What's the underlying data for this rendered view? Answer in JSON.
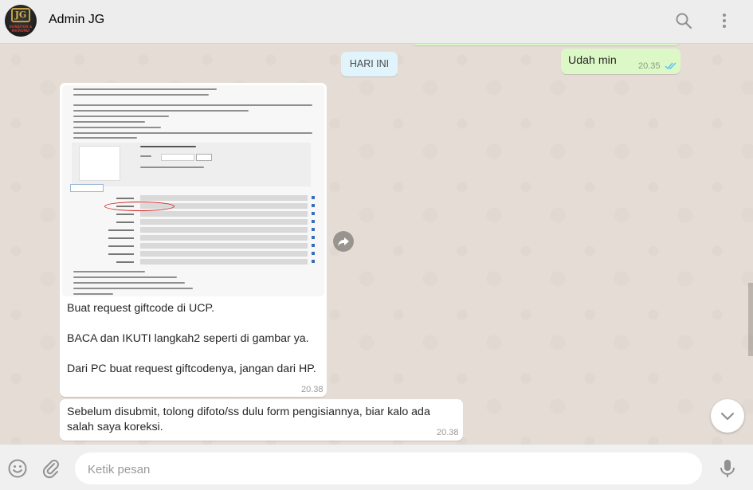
{
  "header": {
    "title": "Admin JG",
    "avatar_text": "JG",
    "avatar_subtext": "DONATION & MICROPAY",
    "icons": [
      "search-icon",
      "menu-icon"
    ]
  },
  "chat": {
    "day_label": "HARI INI",
    "outgoing": [
      {
        "text": "Udah min",
        "time": "20.35",
        "status": "read"
      }
    ],
    "incoming": [
      {
        "has_image": true,
        "lines": [
          "Buat request giftcode di UCP.",
          "BACA dan IKUTI langkah2 seperti di gambar ya.",
          "Dari PC buat request giftcodenya, jangan dari HP."
        ],
        "time": "20.38"
      },
      {
        "lines": [
          "Sebelum disubmit, tolong difoto/ss dulu form pengisiannya, biar kalo ada",
          "salah saya koreksi."
        ],
        "time": "20.38"
      }
    ]
  },
  "footer": {
    "placeholder": "Ketik pesan",
    "icons": [
      "emoji-icon",
      "attach-icon",
      "microphone-icon"
    ]
  },
  "colors": {
    "header_bg": "#ededed",
    "chat_bg": "#e5ddd5",
    "outgoing_bubble": "#dcf8c6",
    "incoming_bubble": "#ffffff",
    "read_ticks": "#4fc3f7",
    "day_pill": "#e1f3fb"
  }
}
